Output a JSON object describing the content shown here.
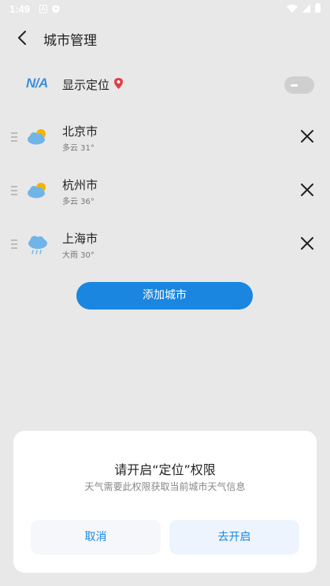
{
  "status_bar": {
    "time": "1:49"
  },
  "header": {
    "title": "城市管理"
  },
  "location": {
    "badge": "N/A",
    "label": "显示定位"
  },
  "cities": [
    {
      "name": "北京市",
      "weather": "多云 31°",
      "icon": "partly-cloudy"
    },
    {
      "name": "杭州市",
      "weather": "多云 36°",
      "icon": "partly-cloudy"
    },
    {
      "name": "上海市",
      "weather": "大雨 30°",
      "icon": "heavy-rain"
    }
  ],
  "add_city_label": "添加城市",
  "dialog": {
    "title": "请开启“定位”权限",
    "message": "天气需要此权限获取当前城市天气信息",
    "cancel_label": "取消",
    "confirm_label": "去开启"
  },
  "colors": {
    "accent": "#1a86e0",
    "background": "#e8e8e8",
    "badge": "#3d8fdb"
  }
}
